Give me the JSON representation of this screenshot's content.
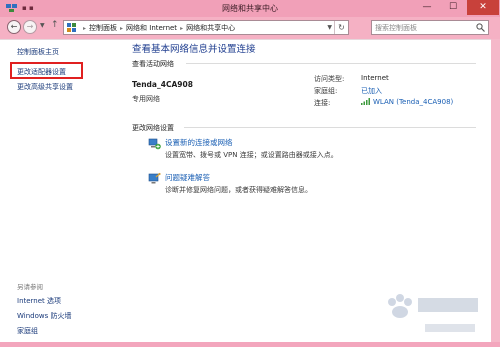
{
  "window": {
    "title": "网络和共享中心",
    "min_glyph": "—",
    "max_glyph": "☐",
    "close_glyph": "✕",
    "close_color": "#c8413b"
  },
  "nav": {
    "back_glyph": "←",
    "forward_glyph": "→",
    "dropdown_glyph": "▼",
    "up_glyph": "↑",
    "refresh_glyph": "↻"
  },
  "address": {
    "crumbs": [
      "控制面板",
      "网络和 Internet",
      "网络和共享中心"
    ],
    "separator": "▸",
    "dropdown_glyph": "▼"
  },
  "search": {
    "placeholder": "搜索控制面板"
  },
  "sidebar": {
    "home": "控制面板主页",
    "adapter": "更改适配器设置",
    "advanced": "更改高级共享设置",
    "see_also": "另请参阅",
    "links": [
      "Internet 选项",
      "Windows 防火墙",
      "家庭组"
    ]
  },
  "main": {
    "heading": "查看基本网络信息并设置连接",
    "active_section": "查看活动网络",
    "network": {
      "name": "Tenda_4CA908",
      "type": "专用网络"
    },
    "info": {
      "access_label": "访问类型:",
      "access_value": "Internet",
      "homegroup_label": "家庭组:",
      "homegroup_value": "已加入",
      "connection_label": "连接:",
      "connection_value": "WLAN (Tenda_4CA908)"
    },
    "change_section": "更改网络设置",
    "tasks": {
      "new_connection": {
        "link": "设置新的连接或网络",
        "desc": "设置宽带、拨号或 VPN 连接；或设置路由器或接入点。"
      },
      "troubleshoot": {
        "link": "问题疑难解答",
        "desc": "诊断并修复网络问题，或者获得疑难解答信息。"
      }
    }
  },
  "colors": {
    "titlebar": "#f1a0b8",
    "link": "#1a5fb4",
    "heading": "#1e3d8f",
    "highlight": "#e02020"
  }
}
